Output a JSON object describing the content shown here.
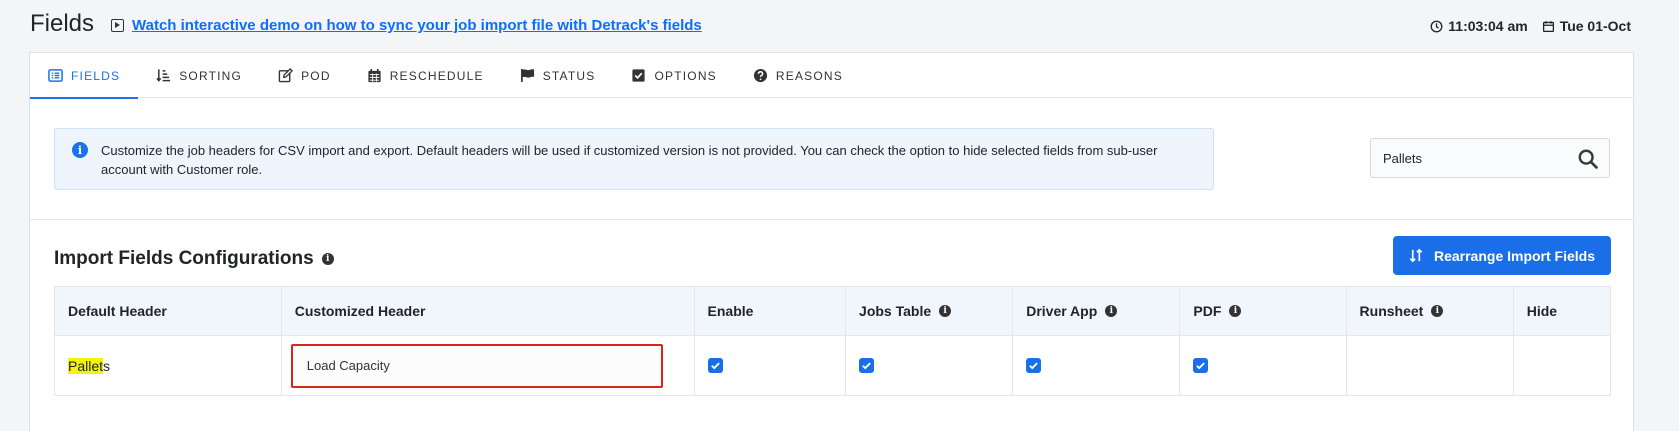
{
  "header": {
    "title": "Fields",
    "demo_link": "Watch interactive demo on how to sync your job import file with Detrack's fields",
    "time": "11:03:04 am",
    "date": "Tue 01-Oct"
  },
  "tabs": [
    {
      "label": "FIELDS",
      "icon": "list-icon",
      "active": true
    },
    {
      "label": "SORTING",
      "icon": "sort-icon",
      "active": false
    },
    {
      "label": "POD",
      "icon": "edit-icon",
      "active": false
    },
    {
      "label": "RESCHEDULE",
      "icon": "calendar-icon",
      "active": false
    },
    {
      "label": "STATUS",
      "icon": "flag-icon",
      "active": false
    },
    {
      "label": "OPTIONS",
      "icon": "checkbox-icon",
      "active": false
    },
    {
      "label": "REASONS",
      "icon": "question-icon",
      "active": false
    }
  ],
  "info": {
    "text": "Customize the job headers for CSV import and export. Default headers will be used if customized version is not provided. You can check the option to hide selected fields from sub-user account with Customer role."
  },
  "search": {
    "value": "Pallets"
  },
  "section": {
    "title": "Import Fields Configurations",
    "button_label": "Rearrange Import Fields"
  },
  "table": {
    "columns": [
      "Default Header",
      "Customized Header",
      "Enable",
      "Jobs Table",
      "Driver App",
      "PDF",
      "Runsheet",
      "Hide"
    ],
    "row": {
      "default_header_match": "Pallet",
      "default_header_rest": "s",
      "customized_header": "Load Capacity",
      "enable": true,
      "jobs_table": true,
      "driver_app": true,
      "pdf": true
    }
  },
  "colors": {
    "accent": "#1a6fe8",
    "highlight": "#f4f40a",
    "error_border": "#d9261c"
  }
}
